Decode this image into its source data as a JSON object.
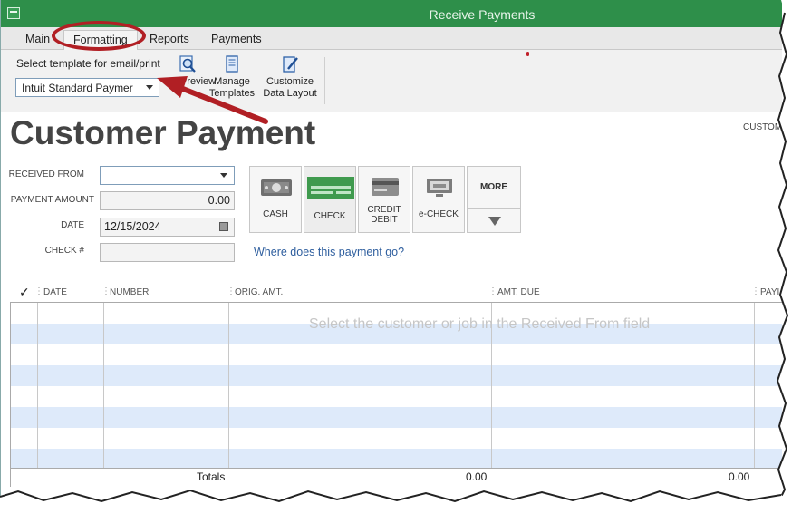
{
  "window": {
    "title": "Receive Payments"
  },
  "menu_tabs": [
    "Main",
    "Formatting",
    "Reports",
    "Payments"
  ],
  "ribbon": {
    "template_label": "Select template for email/print",
    "template_value": "Intuit Standard Paymer",
    "preview_label": "Preview",
    "manage_label_1": "Manage",
    "manage_label_2": "Templates",
    "customize_label_1": "Customize",
    "customize_label_2": "Data Layout"
  },
  "form": {
    "title": "Customer Payment",
    "customer_balance_label": "CUSTOMER",
    "received_from_label": "RECEIVED FROM",
    "received_from_value": "",
    "payment_amount_label": "PAYMENT AMOUNT",
    "payment_amount_value": "0.00",
    "date_label": "DATE",
    "date_value": "12/15/2024",
    "check_label": "CHECK #",
    "check_value": "",
    "where_link": "Where does this payment go?"
  },
  "payment_methods": [
    {
      "label_1": "CASH",
      "label_2": ""
    },
    {
      "label_1": "CHECK",
      "label_2": ""
    },
    {
      "label_1": "CREDIT",
      "label_2": "DEBIT"
    },
    {
      "label_1": "e-CHECK",
      "label_2": ""
    }
  ],
  "more_label": "MORE",
  "table": {
    "check_mark": "✓",
    "columns": [
      "DATE",
      "NUMBER",
      "ORIG. AMT.",
      "AMT. DUE",
      "PAYI"
    ],
    "empty_hint": "Select the customer or job in the Received From field",
    "totals_label": "Totals",
    "totals_amt_due": "0.00",
    "totals_payment": "0.00"
  },
  "colors": {
    "titlebar": "#2e8f4a",
    "annotation": "#b11f24",
    "row_alt": "#deeafa",
    "link": "#2e5e9e"
  }
}
